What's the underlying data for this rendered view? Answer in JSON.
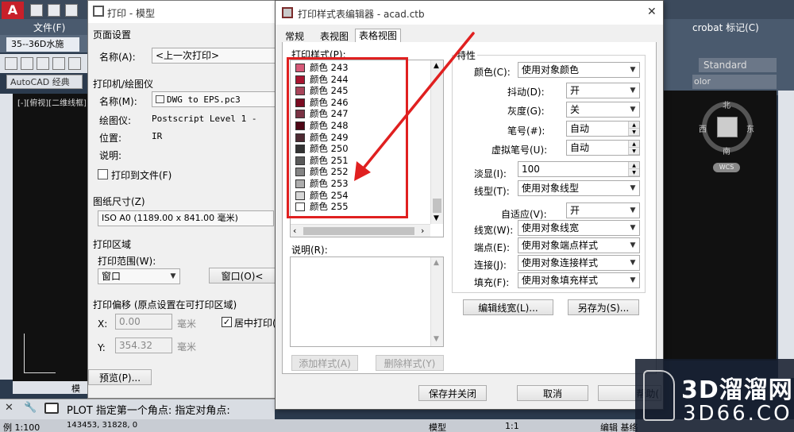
{
  "cad": {
    "app_letter": "A",
    "menu_file": "文件(F)",
    "doc_tab": "35--36D水施",
    "workspace": "AutoCAD 经典",
    "viewport_label": "[-][俯视][二维线框]",
    "model_tab": "模",
    "acrobat": "crobat 标记(C)",
    "style_select": "Standard",
    "color_select": "olor",
    "viewcube": {
      "n": "北",
      "s": "南",
      "e": "东",
      "w": "西",
      "wcs": "WCS"
    },
    "cmd_prompt": "PLOT 指定第一个角点: 指定对角点:",
    "status_scale": "例 1:100",
    "status_coords": "143453, 31828, 0",
    "status_model": "模型",
    "status_annot": "1:1",
    "status_edit": "编辑 基络"
  },
  "plot": {
    "title": "打印 - 模型",
    "page_setup": {
      "group": "页面设置",
      "name_label": "名称(A):",
      "name_value": "<上一次打印>"
    },
    "printer": {
      "group": "打印机/绘图仪",
      "name_label": "名称(M):",
      "name_value": "DWG to EPS.pc3",
      "plotter_label": "绘图仪:",
      "plotter_value": "Postscript Level 1 -",
      "where_label": "位置:",
      "where_value": "IR",
      "desc_label": "说明:",
      "to_file": "打印到文件(F)"
    },
    "paper": {
      "group": "图纸尺寸(Z)",
      "value": "ISO A0 (1189.00 x 841.00 毫米)"
    },
    "area": {
      "group": "打印区域",
      "range_label": "打印范围(W):",
      "range_value": "窗口",
      "window_button": "窗口(O)<"
    },
    "offset": {
      "group": "打印偏移 (原点设置在可打印区域)",
      "x_label": "X:",
      "x_value": "0.00",
      "y_label": "Y:",
      "y_value": "354.32",
      "unit": "毫米",
      "center": "居中打印("
    },
    "preview_button": "预览(P)..."
  },
  "editor": {
    "title": "打印样式表编辑器 - acad.ctb",
    "tabs": [
      "常规",
      "表视图",
      "表格视图"
    ],
    "styles_label": "打印样式(P):",
    "styles": [
      {
        "name": "颜色 243",
        "color": "#d65a78"
      },
      {
        "name": "颜色 244",
        "color": "#a81530"
      },
      {
        "name": "颜色 245",
        "color": "#a8455a"
      },
      {
        "name": "颜色 246",
        "color": "#7a0c22"
      },
      {
        "name": "颜色 247",
        "color": "#7a3344"
      },
      {
        "name": "颜色 248",
        "color": "#4e0716"
      },
      {
        "name": "颜色 249",
        "color": "#4e2a32"
      },
      {
        "name": "颜色 250",
        "color": "#333333"
      },
      {
        "name": "颜色 251",
        "color": "#5a5a5a"
      },
      {
        "name": "颜色 252",
        "color": "#848484"
      },
      {
        "name": "颜色 253",
        "color": "#adadad"
      },
      {
        "name": "颜色 254",
        "color": "#d6d6d6"
      },
      {
        "name": "颜色 255",
        "color": "#ffffff"
      }
    ],
    "desc_label": "说明(R):",
    "add_style": "添加样式(A)",
    "delete_style": "删除样式(Y)",
    "props": {
      "group": "特性",
      "color_label": "颜色(C):",
      "color_value": "使用对象颜色",
      "dither_label": "抖动(D):",
      "dither_value": "开",
      "gray_label": "灰度(G):",
      "gray_value": "关",
      "pen_label": "笔号(#):",
      "pen_value": "自动",
      "vpen_label": "虚拟笔号(U):",
      "vpen_value": "自动",
      "screen_label": "淡显(I):",
      "screen_value": "100",
      "linetype_label": "线型(T):",
      "linetype_value": "使用对象线型",
      "adaptive_label": "自适应(V):",
      "adaptive_value": "开",
      "lineweight_label": "线宽(W):",
      "lineweight_value": "使用对象线宽",
      "endstyle_label": "端点(E):",
      "endstyle_value": "使用对象端点样式",
      "joinstyle_label": "连接(J):",
      "joinstyle_value": "使用对象连接样式",
      "fill_label": "填充(F):",
      "fill_value": "使用对象填充样式"
    },
    "edit_lineweights": "编辑线宽(L)...",
    "save_as": "另存为(S)...",
    "save_close": "保存并关闭",
    "cancel": "取消",
    "help": "帮助("
  },
  "watermark": {
    "brand": "3D溜溜网",
    "url": "3D66.COM"
  },
  "annotation_color": "#e02020"
}
